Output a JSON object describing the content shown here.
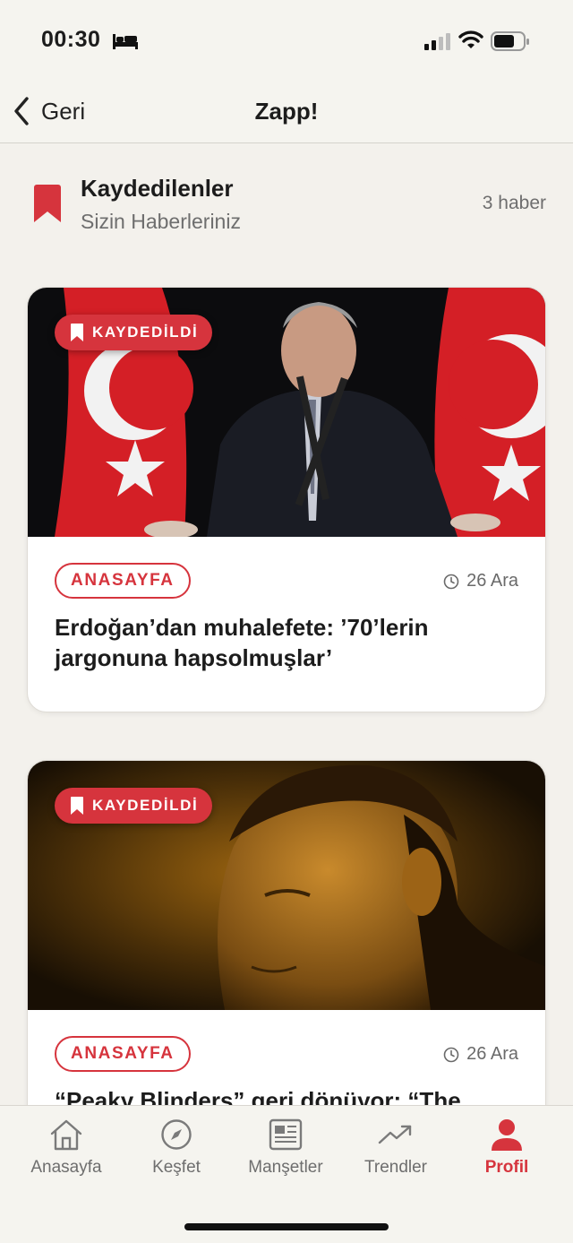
{
  "status_bar": {
    "time": "00:30"
  },
  "nav": {
    "back_label": "Geri",
    "title": "Zapp!"
  },
  "section": {
    "title": "Kaydedilenler",
    "subtitle": "Sizin Haberleriniz",
    "count": "3 haber"
  },
  "articles": [
    {
      "badge": "KAYDEDİLDİ",
      "category": "ANASAYFA",
      "date": "26 Ara",
      "title": "Erdoğan’dan muhalefete: ’70’lerin jargonuna hapsolmuşlar’"
    },
    {
      "badge": "KAYDEDİLDİ",
      "category": "ANASAYFA",
      "date": "26 Ara",
      "title": "“Peaky Blinders” geri dönüyor: “The"
    }
  ],
  "tabs": [
    {
      "label": "Anasayfa",
      "icon": "home-icon"
    },
    {
      "label": "Keşfet",
      "icon": "compass-icon"
    },
    {
      "label": "Manşetler",
      "icon": "newspaper-icon"
    },
    {
      "label": "Trendler",
      "icon": "trending-icon"
    },
    {
      "label": "Profil",
      "icon": "person-icon",
      "active": true
    }
  ],
  "colors": {
    "accent": "#d6343d",
    "background": "#f3f1ec"
  }
}
